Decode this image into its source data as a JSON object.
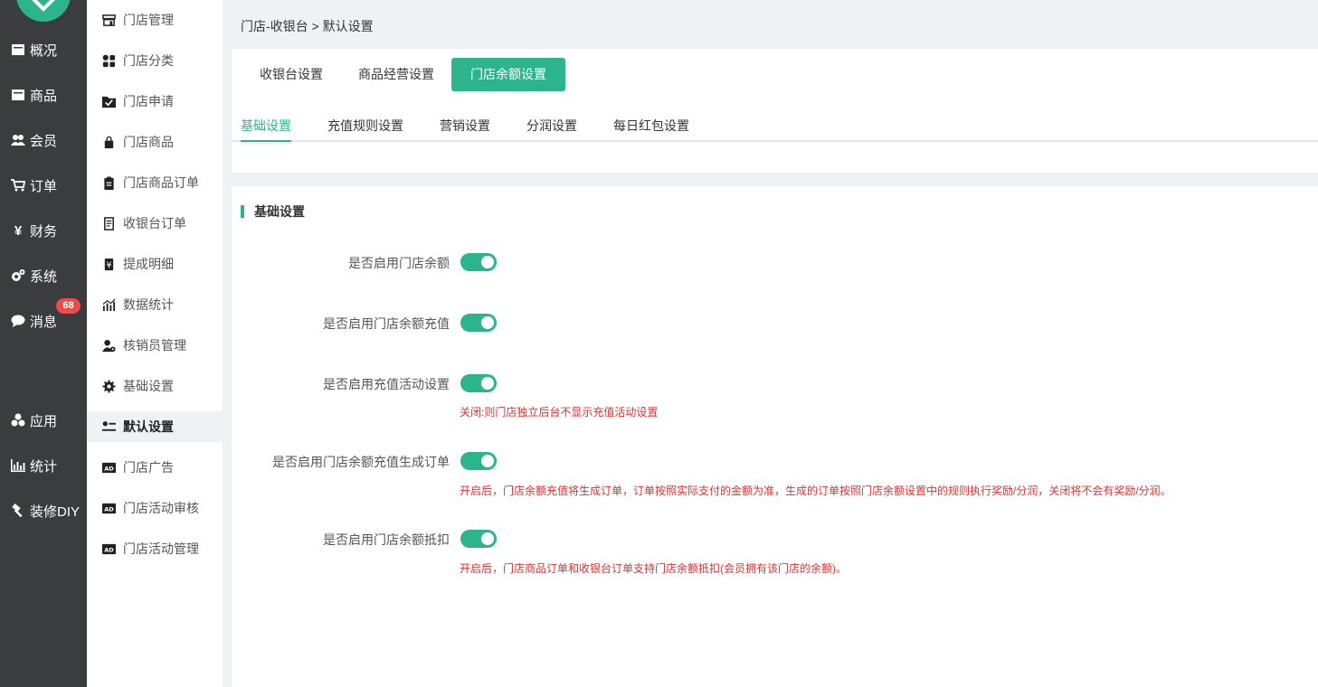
{
  "sidebar": {
    "items": [
      {
        "label": "概况",
        "icon": "home-icon"
      },
      {
        "label": "商品",
        "icon": "box-icon"
      },
      {
        "label": "会员",
        "icon": "users-icon"
      },
      {
        "label": "订单",
        "icon": "cart-icon"
      },
      {
        "label": "财务",
        "icon": "yen-icon"
      },
      {
        "label": "系统",
        "icon": "gears-icon"
      },
      {
        "label": "消息",
        "icon": "chat-icon",
        "badge": "68"
      },
      {
        "label": "应用",
        "icon": "cubes-icon"
      },
      {
        "label": "统计",
        "icon": "bar-chart-icon"
      },
      {
        "label": "装修DIY",
        "icon": "hammer-icon"
      }
    ]
  },
  "subnav": {
    "items": [
      {
        "label": "门店管理",
        "icon": "store-icon"
      },
      {
        "label": "门店分类",
        "icon": "grid-icon"
      },
      {
        "label": "门店申请",
        "icon": "folder-check-icon"
      },
      {
        "label": "门店商品",
        "icon": "bag-icon"
      },
      {
        "label": "门店商品订单",
        "icon": "clipboard-icon"
      },
      {
        "label": "收银台订单",
        "icon": "receipt-icon"
      },
      {
        "label": "提成明细",
        "icon": "yen-doc-icon"
      },
      {
        "label": "数据统计",
        "icon": "stats-icon"
      },
      {
        "label": "核销员管理",
        "icon": "user-cog-icon"
      },
      {
        "label": "基础设置",
        "icon": "gear-icon"
      },
      {
        "label": "默认设置",
        "icon": "sliders-icon"
      },
      {
        "label": "门店广告",
        "icon": "ad-icon"
      },
      {
        "label": "门店活动审核",
        "icon": "ad-icon"
      },
      {
        "label": "门店活动管理",
        "icon": "ad-icon"
      }
    ]
  },
  "breadcrumb": "门店-收银台 > 默认设置",
  "tabs": [
    "收银台设置",
    "商品经营设置",
    "门店余额设置"
  ],
  "subtabs": [
    "基础设置",
    "充值规则设置",
    "营销设置",
    "分润设置",
    "每日红包设置"
  ],
  "section_title": "基础设置",
  "settings": [
    {
      "label": "是否启用门店余额",
      "enabled": true,
      "hint": ""
    },
    {
      "label": "是否启用门店余额充值",
      "enabled": true,
      "hint": ""
    },
    {
      "label": "是否启用充值活动设置",
      "enabled": true,
      "hint": "关闭:则门店独立后台不显示充值活动设置"
    },
    {
      "label": "是否启用门店余额充值生成订单",
      "enabled": true,
      "hint": "开启后，门店余额充值将生成订单，订单按照实际支付的金额为准，生成的订单按照门店余额设置中的规则执行奖励/分润，关闭将不会有奖励/分润。"
    },
    {
      "label": "是否启用门店余额抵扣",
      "enabled": true,
      "hint": "开启后，门店商品订单和收银台订单支持门店余额抵扣(会员拥有该门店的余额)。"
    }
  ],
  "colors": {
    "accent": "#2cb58c",
    "nav_bg": "#3b3c3e",
    "hint_red": "#e03030",
    "badge_red": "#f04a4a"
  }
}
